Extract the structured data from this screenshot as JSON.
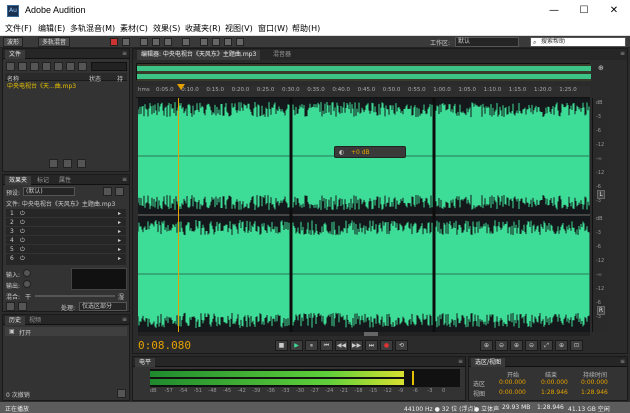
{
  "window": {
    "title": "Adobe Audition",
    "icon": "Au",
    "minimize": "—",
    "maximize": "☐",
    "close": "✕"
  },
  "menu": [
    "文件(F)",
    "编辑(E)",
    "多轨混音(M)",
    "素材(C)",
    "效果(S)",
    "收藏夹(R)",
    "视图(V)",
    "窗口(W)",
    "帮助(H)"
  ],
  "toolbar": {
    "waveform_label": "波形",
    "multitrack_label": "多轨混音",
    "workspace_label": "工作区:",
    "workspace_value": "默认",
    "search_placeholder": "搜索帮助"
  },
  "files_panel": {
    "tab": "文件",
    "col_name": "名称",
    "col_status": "状态",
    "col_duration": "持",
    "item": "中央电视台《天...曲.mp3"
  },
  "effects_panel": {
    "tabs": [
      "效果夹",
      "标记",
      "属性"
    ],
    "preset_label": "预设:",
    "preset_value": "(默认)",
    "file_line": "文件: 中央电视台《天风东》主题曲.mp3",
    "slots": [
      "1",
      "2",
      "3",
      "4",
      "5",
      "6"
    ],
    "input_label": "输入:",
    "output_label": "输出:",
    "mix_label": "混合:",
    "mix_dry": "干",
    "mix_wet": "湿",
    "process_label": "处理:",
    "process_value": "仅选区部分"
  },
  "history_panel": {
    "tabs": [
      "历史",
      "视频"
    ],
    "item": "打开",
    "count": "0 次撤销"
  },
  "editor": {
    "tab": "编辑器: 中央电视台《天风东》主题曲.mp3",
    "mixer_tab": "混音器",
    "ruler_start": "hms",
    "ruler": [
      "0:05.0",
      "0:10.0",
      "0:15.0",
      "0:20.0",
      "0:25.0",
      "0:30.0",
      "0:35.0",
      "0:40.0",
      "0:45.0",
      "0:50.0",
      "0:55.0",
      "1:00.0",
      "1:05.0",
      "1:10.0",
      "1:15.0",
      "1:20.0",
      "1:25.0"
    ],
    "db_top": [
      "dB",
      "-3",
      "-6",
      "-12",
      "-∞",
      "-12",
      "-6",
      "-3"
    ],
    "db_bottom": [
      "dB",
      "-3",
      "-6",
      "-12",
      "-∞",
      "-12",
      "-6",
      "-3"
    ],
    "hud_gain": "+0 dB",
    "channel_left": "L",
    "channel_right": "R",
    "timecode": "0:08.080",
    "transport": [
      "■",
      "▶",
      "⏸",
      "⏮",
      "◀◀",
      "▶▶",
      "⏭",
      "●",
      "⟲"
    ]
  },
  "levels_panel": {
    "tab": "电平",
    "scale": [
      "dB",
      "-57",
      "-54",
      "-51",
      "-48",
      "-45",
      "-42",
      "-39",
      "-36",
      "-33",
      "-30",
      "-27",
      "-24",
      "-21",
      "-18",
      "-15",
      "-12",
      "-9",
      "-6",
      "-3",
      "0"
    ]
  },
  "selection_panel": {
    "tab": "选区/视图",
    "headers": [
      "开始",
      "结束",
      "持续时间"
    ],
    "rows": [
      {
        "label": "选区",
        "start": "0:00.000",
        "end": "0:00.000",
        "duration": "0:00.000"
      },
      {
        "label": "视图",
        "start": "0:00.000",
        "end": "1:28.946",
        "duration": "1:28.946"
      }
    ]
  },
  "status": {
    "left": "正在播放",
    "rate": "44100 Hz ● 32 位 (浮点)",
    "channels": "● 立体声",
    "size": "29.93 MB",
    "duration": "1:28.946",
    "free": "41.13 GB 空闲"
  },
  "colors": {
    "waveform": "#3ddc97",
    "accent": "#e5a100",
    "background": "#2b2b2b"
  }
}
